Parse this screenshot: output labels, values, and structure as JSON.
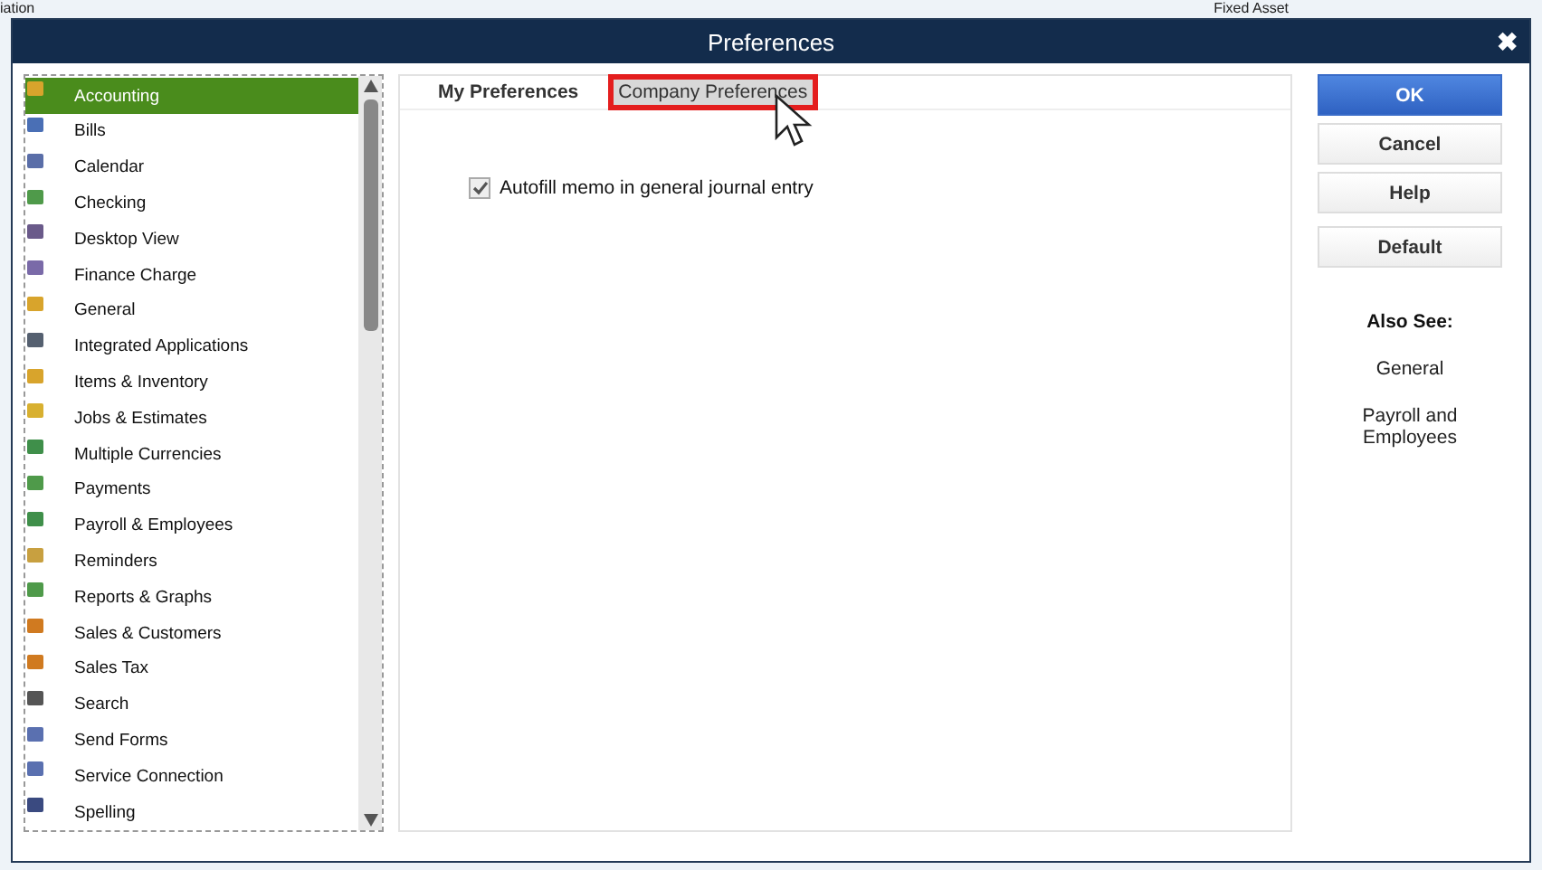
{
  "background": {
    "left_text": "iation",
    "right_text": "Fixed Asset"
  },
  "window": {
    "title": "Preferences",
    "close": "✖"
  },
  "sidebar": {
    "items": [
      {
        "label": "Accounting",
        "selected": true,
        "color": "#d8a42c"
      },
      {
        "label": "Bills",
        "selected": false,
        "color": "#4a6fb5"
      },
      {
        "label": "Calendar",
        "selected": false,
        "color": "#5a6ea8"
      },
      {
        "label": "Checking",
        "selected": false,
        "color": "#4f9a4a"
      },
      {
        "label": "Desktop View",
        "selected": false,
        "color": "#6a5a8a"
      },
      {
        "label": "Finance Charge",
        "selected": false,
        "color": "#7a6aa8"
      },
      {
        "label": "General",
        "selected": false,
        "color": "#d8a42c"
      },
      {
        "label": "Integrated Applications",
        "selected": false,
        "color": "#556070"
      },
      {
        "label": "Items & Inventory",
        "selected": false,
        "color": "#d8a42c"
      },
      {
        "label": "Jobs & Estimates",
        "selected": false,
        "color": "#d8b030"
      },
      {
        "label": "Multiple Currencies",
        "selected": false,
        "color": "#3f8f4a"
      },
      {
        "label": "Payments",
        "selected": false,
        "color": "#4f9a4a"
      },
      {
        "label": "Payroll & Employees",
        "selected": false,
        "color": "#3f8f4a"
      },
      {
        "label": "Reminders",
        "selected": false,
        "color": "#c8a040"
      },
      {
        "label": "Reports & Graphs",
        "selected": false,
        "color": "#4f9a4a"
      },
      {
        "label": "Sales & Customers",
        "selected": false,
        "color": "#d07a20"
      },
      {
        "label": "Sales Tax",
        "selected": false,
        "color": "#d07a20"
      },
      {
        "label": "Search",
        "selected": false,
        "color": "#555555"
      },
      {
        "label": "Send Forms",
        "selected": false,
        "color": "#5a70b0"
      },
      {
        "label": "Service Connection",
        "selected": false,
        "color": "#5a70b0"
      },
      {
        "label": "Spelling",
        "selected": false,
        "color": "#3a4a80"
      }
    ]
  },
  "tabs": [
    {
      "label": "My Preferences",
      "selected": true,
      "highlighted": false
    },
    {
      "label": "Company Preferences",
      "selected": false,
      "highlighted": true
    }
  ],
  "options": [
    {
      "label": "Autofill memo in general journal entry",
      "checked": true
    }
  ],
  "buttons": [
    {
      "label": "OK",
      "kind": "primary"
    },
    {
      "label": "Cancel",
      "kind": "normal"
    },
    {
      "label": "Help",
      "kind": "normal"
    },
    {
      "label": "Default",
      "kind": "normal"
    }
  ],
  "also_see": {
    "heading": "Also See:",
    "links": [
      "General",
      "Payroll and Employees"
    ]
  }
}
